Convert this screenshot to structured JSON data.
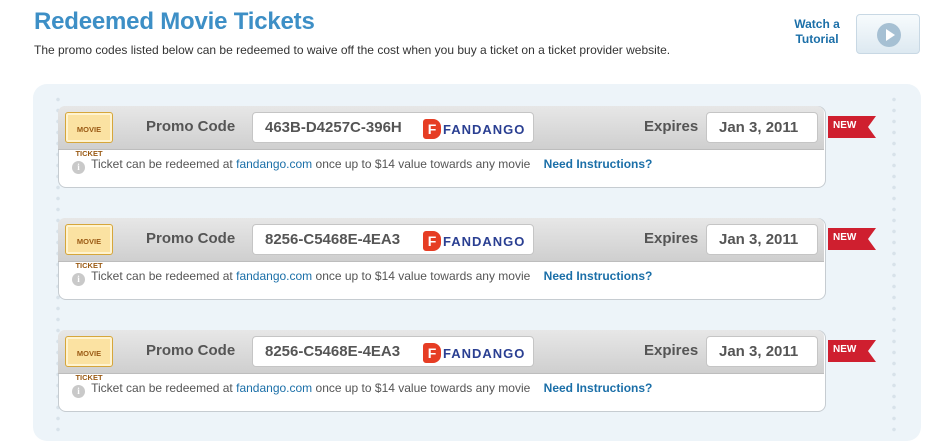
{
  "header": {
    "title": "Redeemed Movie Tickets",
    "subtitle": "The promo codes listed below can be redeemed to waive off the cost when you buy a ticket on a ticket provider website.",
    "tutorial_label_line1": "Watch a",
    "tutorial_label_line2": "Tutorial",
    "tutorial_icon": "play-icon"
  },
  "colors": {
    "title": "#3d8fc6",
    "link": "#1b6fa8",
    "new_tag": "#cf1f2f",
    "fandango_red": "#e63d24",
    "fandango_blue": "#2a3f92"
  },
  "tickets": [
    {
      "badge_line1": "MOVIE",
      "badge_line2": "TICKET",
      "promo_label": "Promo Code",
      "promo_code": "463B-D4257C-396H",
      "provider_icon": "F",
      "provider": "FANDANGO",
      "expires_label": "Expires",
      "expires_date": "Jan 3, 2011",
      "tag": "NEW",
      "info_prefix": "Ticket can be redeemed at",
      "info_link": "fandango.com",
      "info_suffix": "once up to $14 value towards any movie",
      "instructions": "Need Instructions?"
    },
    {
      "badge_line1": "MOVIE",
      "badge_line2": "TICKET",
      "promo_label": "Promo Code",
      "promo_code": "8256-C5468E-4EA3",
      "provider_icon": "F",
      "provider": "FANDANGO",
      "expires_label": "Expires",
      "expires_date": "Jan 3, 2011",
      "tag": "NEW",
      "info_prefix": "Ticket can be redeemed at",
      "info_link": "fandango.com",
      "info_suffix": "once up to $14 value towards any movie",
      "instructions": "Need Instructions?"
    },
    {
      "badge_line1": "MOVIE",
      "badge_line2": "TICKET",
      "promo_label": "Promo Code",
      "promo_code": "8256-C5468E-4EA3",
      "provider_icon": "F",
      "provider": "FANDANGO",
      "expires_label": "Expires",
      "expires_date": "Jan 3, 2011",
      "tag": "NEW",
      "info_prefix": "Ticket can be redeemed at",
      "info_link": "fandango.com",
      "info_suffix": "once up to $14 value towards any movie",
      "instructions": "Need Instructions?"
    }
  ]
}
